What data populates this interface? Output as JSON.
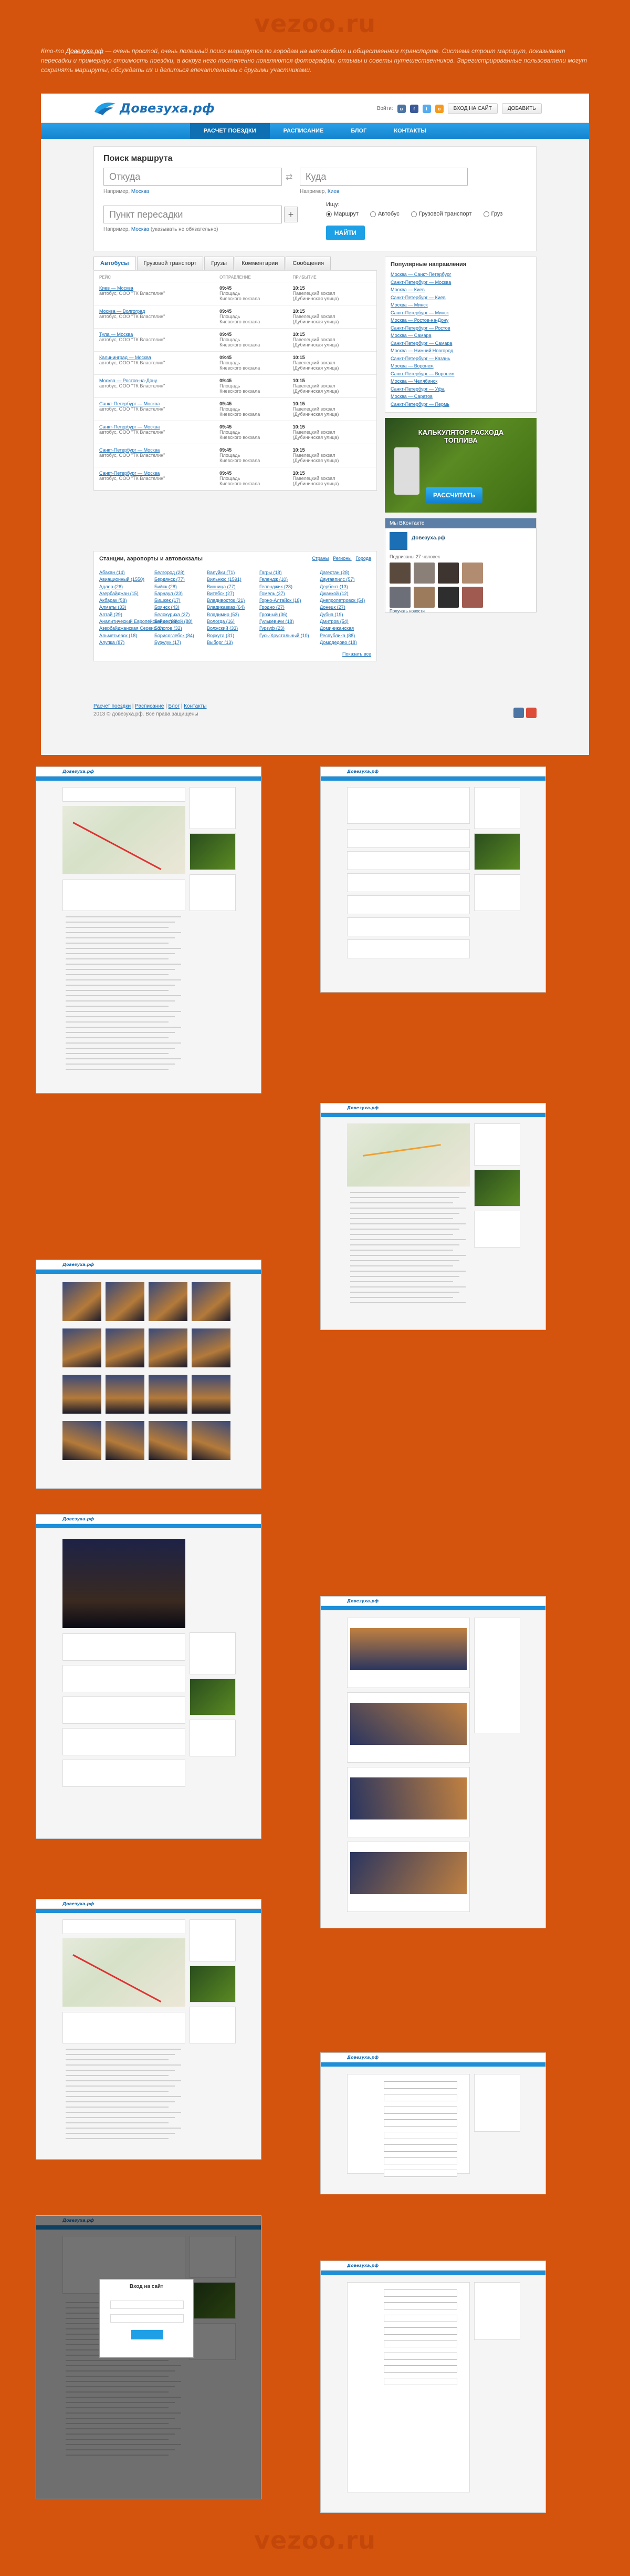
{
  "site_watermark": "vezoo.ru",
  "intro": {
    "prefix": "Кто-то",
    "link": "Довезуха.рф",
    "text": " — очень простой, очень полезный поиск маршрутов по городам на автомобиле и общественном транспорте. Система строит маршрут, показывает пересадки и примерную стоимость поездки, а вокруг него постепенно появляются фотографии, отзывы и советы путешественников.",
    "line2": "Зарегистрированные пользователи могут сохранять маршруты, обсуждать их и делиться впечатлениями с другими участниками."
  },
  "header": {
    "logo": "Довезуха.рф",
    "social_label": "Войти:",
    "login_button": "ВХОД НА САЙТ",
    "add_button": "ДОБАВИТЬ",
    "colors": {
      "accent": "#1e9fe6",
      "brand": "#1b6fb5",
      "background": "#d4540d"
    }
  },
  "nav": [
    "РАСЧЕТ ПОЕЗДКИ",
    "РАСПИСАНИЕ",
    "БЛОГ",
    "КОНТАКТЫ"
  ],
  "search": {
    "title": "Поиск маршрута",
    "from_placeholder": "Откуда",
    "to_placeholder": "Куда",
    "transfer_placeholder": "Пункт пересадки",
    "from_hint_label": "Например,",
    "from_hint_link": "Москва",
    "to_hint_label": "Например,",
    "to_hint_link": "Киев",
    "transfer_hint_label": "Например,",
    "transfer_hint_link": "Москва",
    "transfer_hint_suffix": "(указывать не обязательно)",
    "mode_label": "Ищу:",
    "modes": [
      "Маршрут",
      "Автобус",
      "Грузовой транспорт",
      "Груз"
    ],
    "find_button": "НАЙТИ"
  },
  "tabs": [
    "Автобусы",
    "Грузовой транспорт",
    "Грузы",
    "Комментарии",
    "Сообщения"
  ],
  "table": {
    "headers": [
      "РЕЙС",
      "ОТПРАВЛЕНИЕ",
      "ПРИБЫТИЕ"
    ],
    "rows": [
      {
        "route": "Киев — Москва",
        "carrier": "автобус, ООО \"ТК Властелин\"",
        "dep_time": "09:45",
        "dep_place": "Площадь",
        "dep_place2": "Киевского вокзала",
        "arr_time": "10:15",
        "arr_place": "Павелецкий вокзал",
        "arr_place2": "(Дубининская улица)"
      },
      {
        "route": "Москва — Волгоград",
        "carrier": "автобус, ООО \"ТК Властелин\"",
        "dep_time": "09:45",
        "dep_place": "Площадь",
        "dep_place2": "Киевского вокзала",
        "arr_time": "10:15",
        "arr_place": "Павелецкий вокзал",
        "arr_place2": "(Дубининская улица)"
      },
      {
        "route": "Тула — Москва",
        "carrier": "автобус, ООО \"ТК Властелин\"",
        "dep_time": "09:45",
        "dep_place": "Площадь",
        "dep_place2": "Киевского вокзала",
        "arr_time": "10:15",
        "arr_place": "Павелецкий вокзал",
        "arr_place2": "(Дубининская улица)"
      },
      {
        "route": "Калининград — Москва",
        "carrier": "автобус, ООО \"ТК Властелин\"",
        "dep_time": "09:45",
        "dep_place": "Площадь",
        "dep_place2": "Киевского вокзала",
        "arr_time": "10:15",
        "arr_place": "Павелецкий вокзал",
        "arr_place2": "(Дубининская улица)"
      },
      {
        "route": "Москва — Ростов-на-Дону",
        "carrier": "автобус, ООО \"ТК Властелин\"",
        "dep_time": "09:45",
        "dep_place": "Площадь",
        "dep_place2": "Киевского вокзала",
        "arr_time": "10:15",
        "arr_place": "Павелецкий вокзал",
        "arr_place2": "(Дубининская улица)"
      },
      {
        "route": "Санкт-Петербург — Москва",
        "carrier": "автобус, ООО \"ТК Властелин\"",
        "dep_time": "09:45",
        "dep_place": "Площадь",
        "dep_place2": "Киевского вокзала",
        "arr_time": "10:15",
        "arr_place": "Павелецкий вокзал",
        "arr_place2": "(Дубининская улица)"
      },
      {
        "route": "Санкт-Петербург — Москва",
        "carrier": "автобус, ООО \"ТК Властелин\"",
        "dep_time": "09:45",
        "dep_place": "Площадь",
        "dep_place2": "Киевского вокзала",
        "arr_time": "10:15",
        "arr_place": "Павелецкий вокзал",
        "arr_place2": "(Дубининская улица)"
      },
      {
        "route": "Санкт-Петербург — Москва",
        "carrier": "автобус, ООО \"ТК Властелин\"",
        "dep_time": "09:45",
        "dep_place": "Площадь",
        "dep_place2": "Киевского вокзала",
        "arr_time": "10:15",
        "arr_place": "Павелецкий вокзал",
        "arr_place2": "(Дубининская улица)"
      },
      {
        "route": "Санкт-Петербург — Москва",
        "carrier": "автобус, ООО \"ТК Властелин\"",
        "dep_time": "09:45",
        "dep_place": "Площадь",
        "dep_place2": "Киевского вокзала",
        "arr_time": "10:15",
        "arr_place": "Павелецкий вокзал",
        "arr_place2": "(Дубининская улица)"
      }
    ]
  },
  "popular": {
    "title": "Популярные направления",
    "items": [
      [
        "Москва — Санкт-Петербург",
        "Санкт-Петербург — Москва"
      ],
      [
        "Москва — Киев",
        "Санкт-Петербург — Киев"
      ],
      [
        "Москва — Минск",
        "Санкт-Петербург — Минск"
      ],
      [
        "Москва — Ростов-на-Дону",
        "Санкт-Петербург — Ростов"
      ],
      [
        "Москва — Самара",
        "Санкт-Петербург — Самара"
      ],
      [
        "Москва — Нижний Новгород",
        "Санкт-Петербург — Казань"
      ],
      [
        "Москва — Воронеж",
        "Санкт-Петербург — Воронеж"
      ],
      [
        "Москва — Челябинск",
        "Санкт-Петербург — Уфа"
      ],
      [
        "Москва — Саратов",
        "Санкт-Петербург — Пермь"
      ]
    ]
  },
  "ad": {
    "title": "КАЛЬКУЛЯТОР РАСХОДА ТОПЛИВА",
    "button": "РАССЧИТАТЬ"
  },
  "vk": {
    "header": "Мы ВКонтакте",
    "group": "Довезуха.рф",
    "subscribers": "Подписаны 27 человек",
    "notify": "Получать новости"
  },
  "stations": {
    "title": "Станции, аэропорты и автовокзалы",
    "filters": [
      "Страны",
      "Регионы",
      "Города"
    ],
    "cols": [
      [
        "Абакан (14)",
        "Авиационный (1550)",
        "Адлер (26)",
        "Азербайджан (15)",
        "Акбарак (58)",
        "Алматы (33)",
        "Алтай (29)",
        "Аналитический Европейский гостевой (88)",
        "Азербайджанская Сервис (8)",
        "Альметьевск (18)",
        "Алупка (87)"
      ],
      [
        "Белгород (28)",
        "Бердянск (77)",
        "Бийск (28)",
        "Барнаул (23)",
        "Бишкек (17)",
        "Брянск (43)",
        "Белокуриха (27)",
        "Бенде (28)",
        "Бологое (32)",
        "Борисоглебск (84)",
        "Бузулук (17)"
      ],
      [
        "Валуйки (71)",
        "Вильнюс (1591)",
        "Винница (77)",
        "Витебск (27)",
        "Владивосток (21)",
        "Владикавказ (64)",
        "Владимир (53)",
        "Вологда (16)",
        "Волжский (33)",
        "Воркута (31)",
        "Выборг (13)"
      ],
      [
        "Гагры (18)",
        "Гелендж (10)",
        "Геленджик (28)",
        "Гомель (27)",
        "Горно-Алтайск (18)",
        "Гродно (27)",
        "Грозный (36)",
        "Гулькевичи (18)",
        "Гурзуф (23)",
        "Гусь-Хрустальный (10)"
      ],
      [
        "Дагестан (28)",
        "Даугавпилс (57)",
        "Дербент (13)",
        "Джанкой (12)",
        "Днепропетровск (54)",
        "Донецк (27)",
        "Дубна (19)",
        "Дмитров (54)",
        "Доминиканская Республика (88)",
        "Домодедово (18)"
      ]
    ],
    "all_link": "Показать все"
  },
  "footer": {
    "links": [
      "Расчет поездки",
      "Расписание",
      "Блог",
      "Контакты"
    ],
    "copyright": "2013 © довезуха.рф. Все права защищены"
  },
  "thumbs": {
    "logo": "Довезуха.рф",
    "routes": [
      "Москва — Санкт-Петербург",
      "Москва",
      "Санкт-Петербург — Москва"
    ],
    "login_title": "Вход на сайт"
  }
}
